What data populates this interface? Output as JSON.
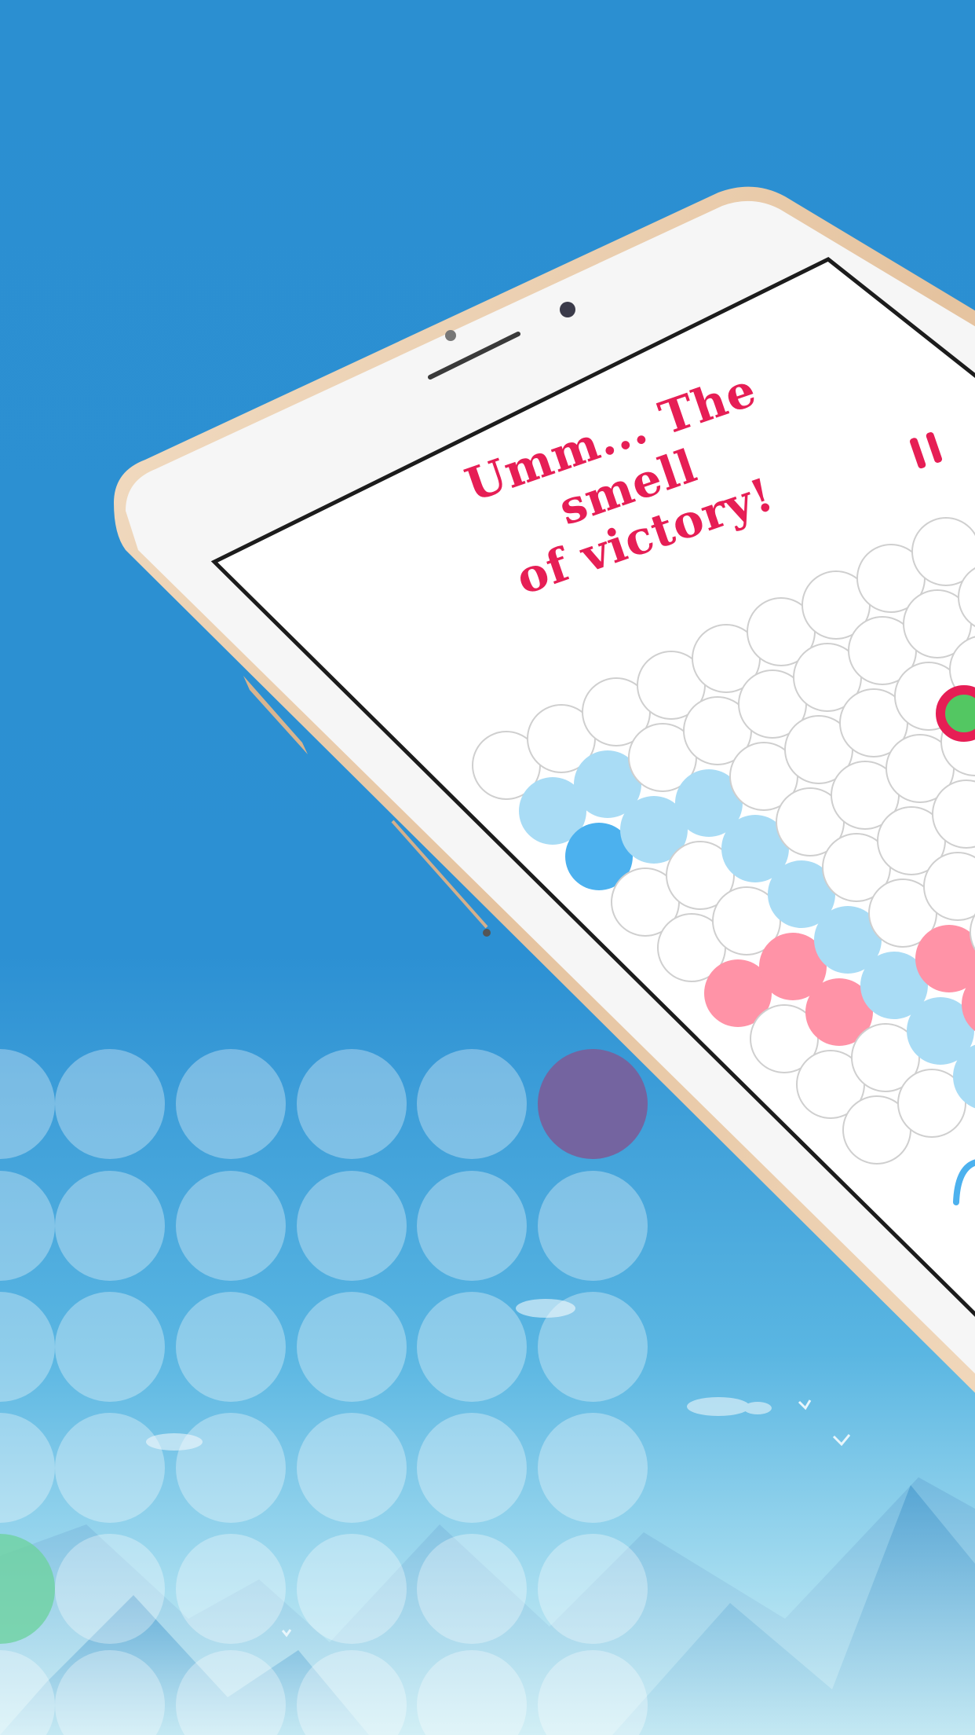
{
  "game": {
    "headline_line1": "Umm... The smell",
    "headline_line2": "of victory!"
  },
  "board": {
    "player_color": "#a9dcf5",
    "player_active_color": "#4cb1ee",
    "opponent_color": "#ff93a7",
    "selection_ring_color": "#e61e55",
    "selection_core_color": "#53c762",
    "empty_fill": "#ffffff"
  },
  "theme": {
    "background": "#2b8fd1",
    "phone_frame": "#f4f4f4",
    "phone_rim": "#e7c8a6",
    "accent": "#e61e55"
  },
  "icons": [
    "pause-icon",
    "restart-icon"
  ]
}
